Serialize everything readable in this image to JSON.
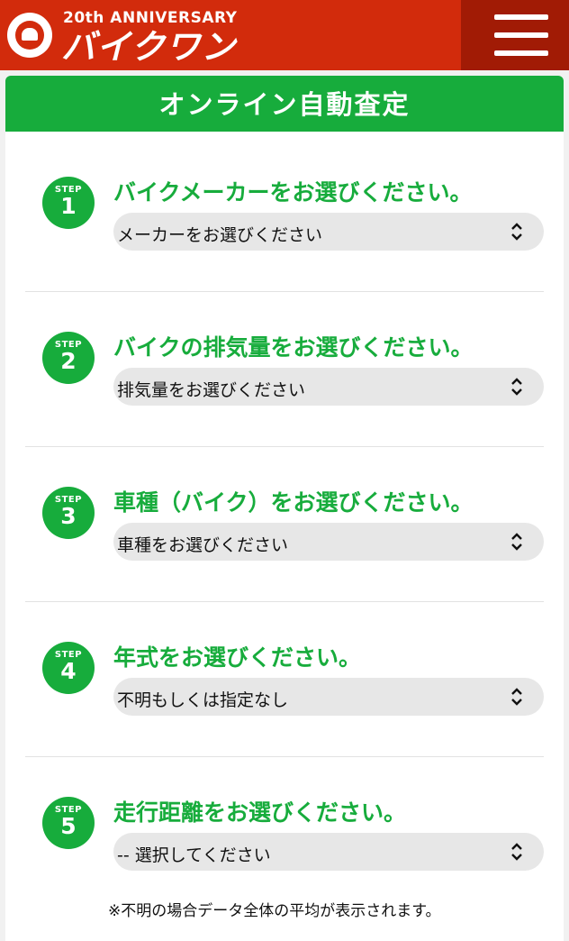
{
  "header": {
    "anniversary": "20th ANNIVERSARY",
    "brand": "バイクワン",
    "colors": {
      "header_bg": "#d22b0c",
      "menu_bg": "#a11b05",
      "accent": "#17ac3c"
    }
  },
  "panel": {
    "title": "オンライン自動査定",
    "steps": [
      {
        "badge_label": "STEP",
        "number": "1",
        "label": "バイクメーカーをお選びください。",
        "selected": "メーカーをお選びください"
      },
      {
        "badge_label": "STEP",
        "number": "2",
        "label": "バイクの排気量をお選びください。",
        "selected": "排気量をお選びください"
      },
      {
        "badge_label": "STEP",
        "number": "3",
        "label": "車種（バイク）をお選びください。",
        "selected": "車種をお選びください"
      },
      {
        "badge_label": "STEP",
        "number": "4",
        "label": "年式をお選びください。",
        "selected": "不明もしくは指定なし"
      },
      {
        "badge_label": "STEP",
        "number": "5",
        "label": "走行距離をお選びください。",
        "selected": "-- 選択してください"
      }
    ],
    "note": "※不明の場合データ全体の平均が表示されます。"
  },
  "icons": {
    "menu": "hamburger-menu-icon",
    "select": "updown-chevron-icon",
    "logo": "bikeone-logo-icon"
  }
}
